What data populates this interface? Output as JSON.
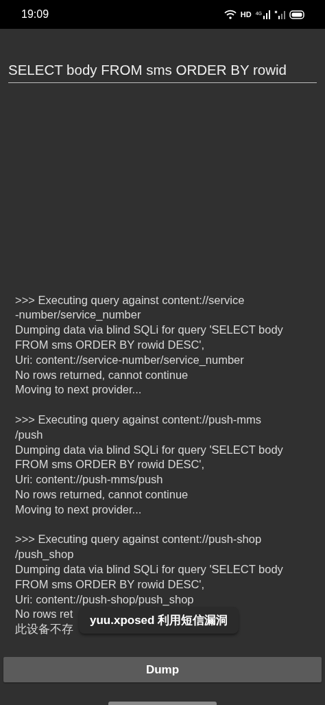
{
  "status_bar": {
    "time": "19:09",
    "hd_label": "HD",
    "network_label": "4G"
  },
  "query_field": {
    "value": "SELECT body FROM sms ORDER BY rowid"
  },
  "log": [
    {
      "lines": [
        ">>> Executing query against content://service",
        "-number/service_number",
        "Dumping data via blind SQLi for query 'SELECT body",
        "FROM sms ORDER BY rowid DESC',",
        "Uri: content://service-number/service_number",
        "No rows returned, cannot continue",
        "Moving to next provider..."
      ]
    },
    {
      "lines": [
        ">>> Executing query against content://push-mms",
        "/push",
        "Dumping data via blind SQLi for query 'SELECT body",
        "FROM sms ORDER BY rowid DESC',",
        "Uri: content://push-mms/push",
        "No rows returned, cannot continue",
        "Moving to next provider..."
      ]
    },
    {
      "lines": [
        ">>> Executing query against content://push-shop",
        "/push_shop",
        "Dumping data via blind SQLi for query 'SELECT body",
        "FROM sms ORDER BY rowid DESC',",
        "Uri: content://push-shop/push_shop",
        "No rows ret",
        "此设备不存"
      ]
    }
  ],
  "toast": {
    "text": "yuu.xposed 利用短信漏洞"
  },
  "dump_button": {
    "label": "Dump"
  }
}
